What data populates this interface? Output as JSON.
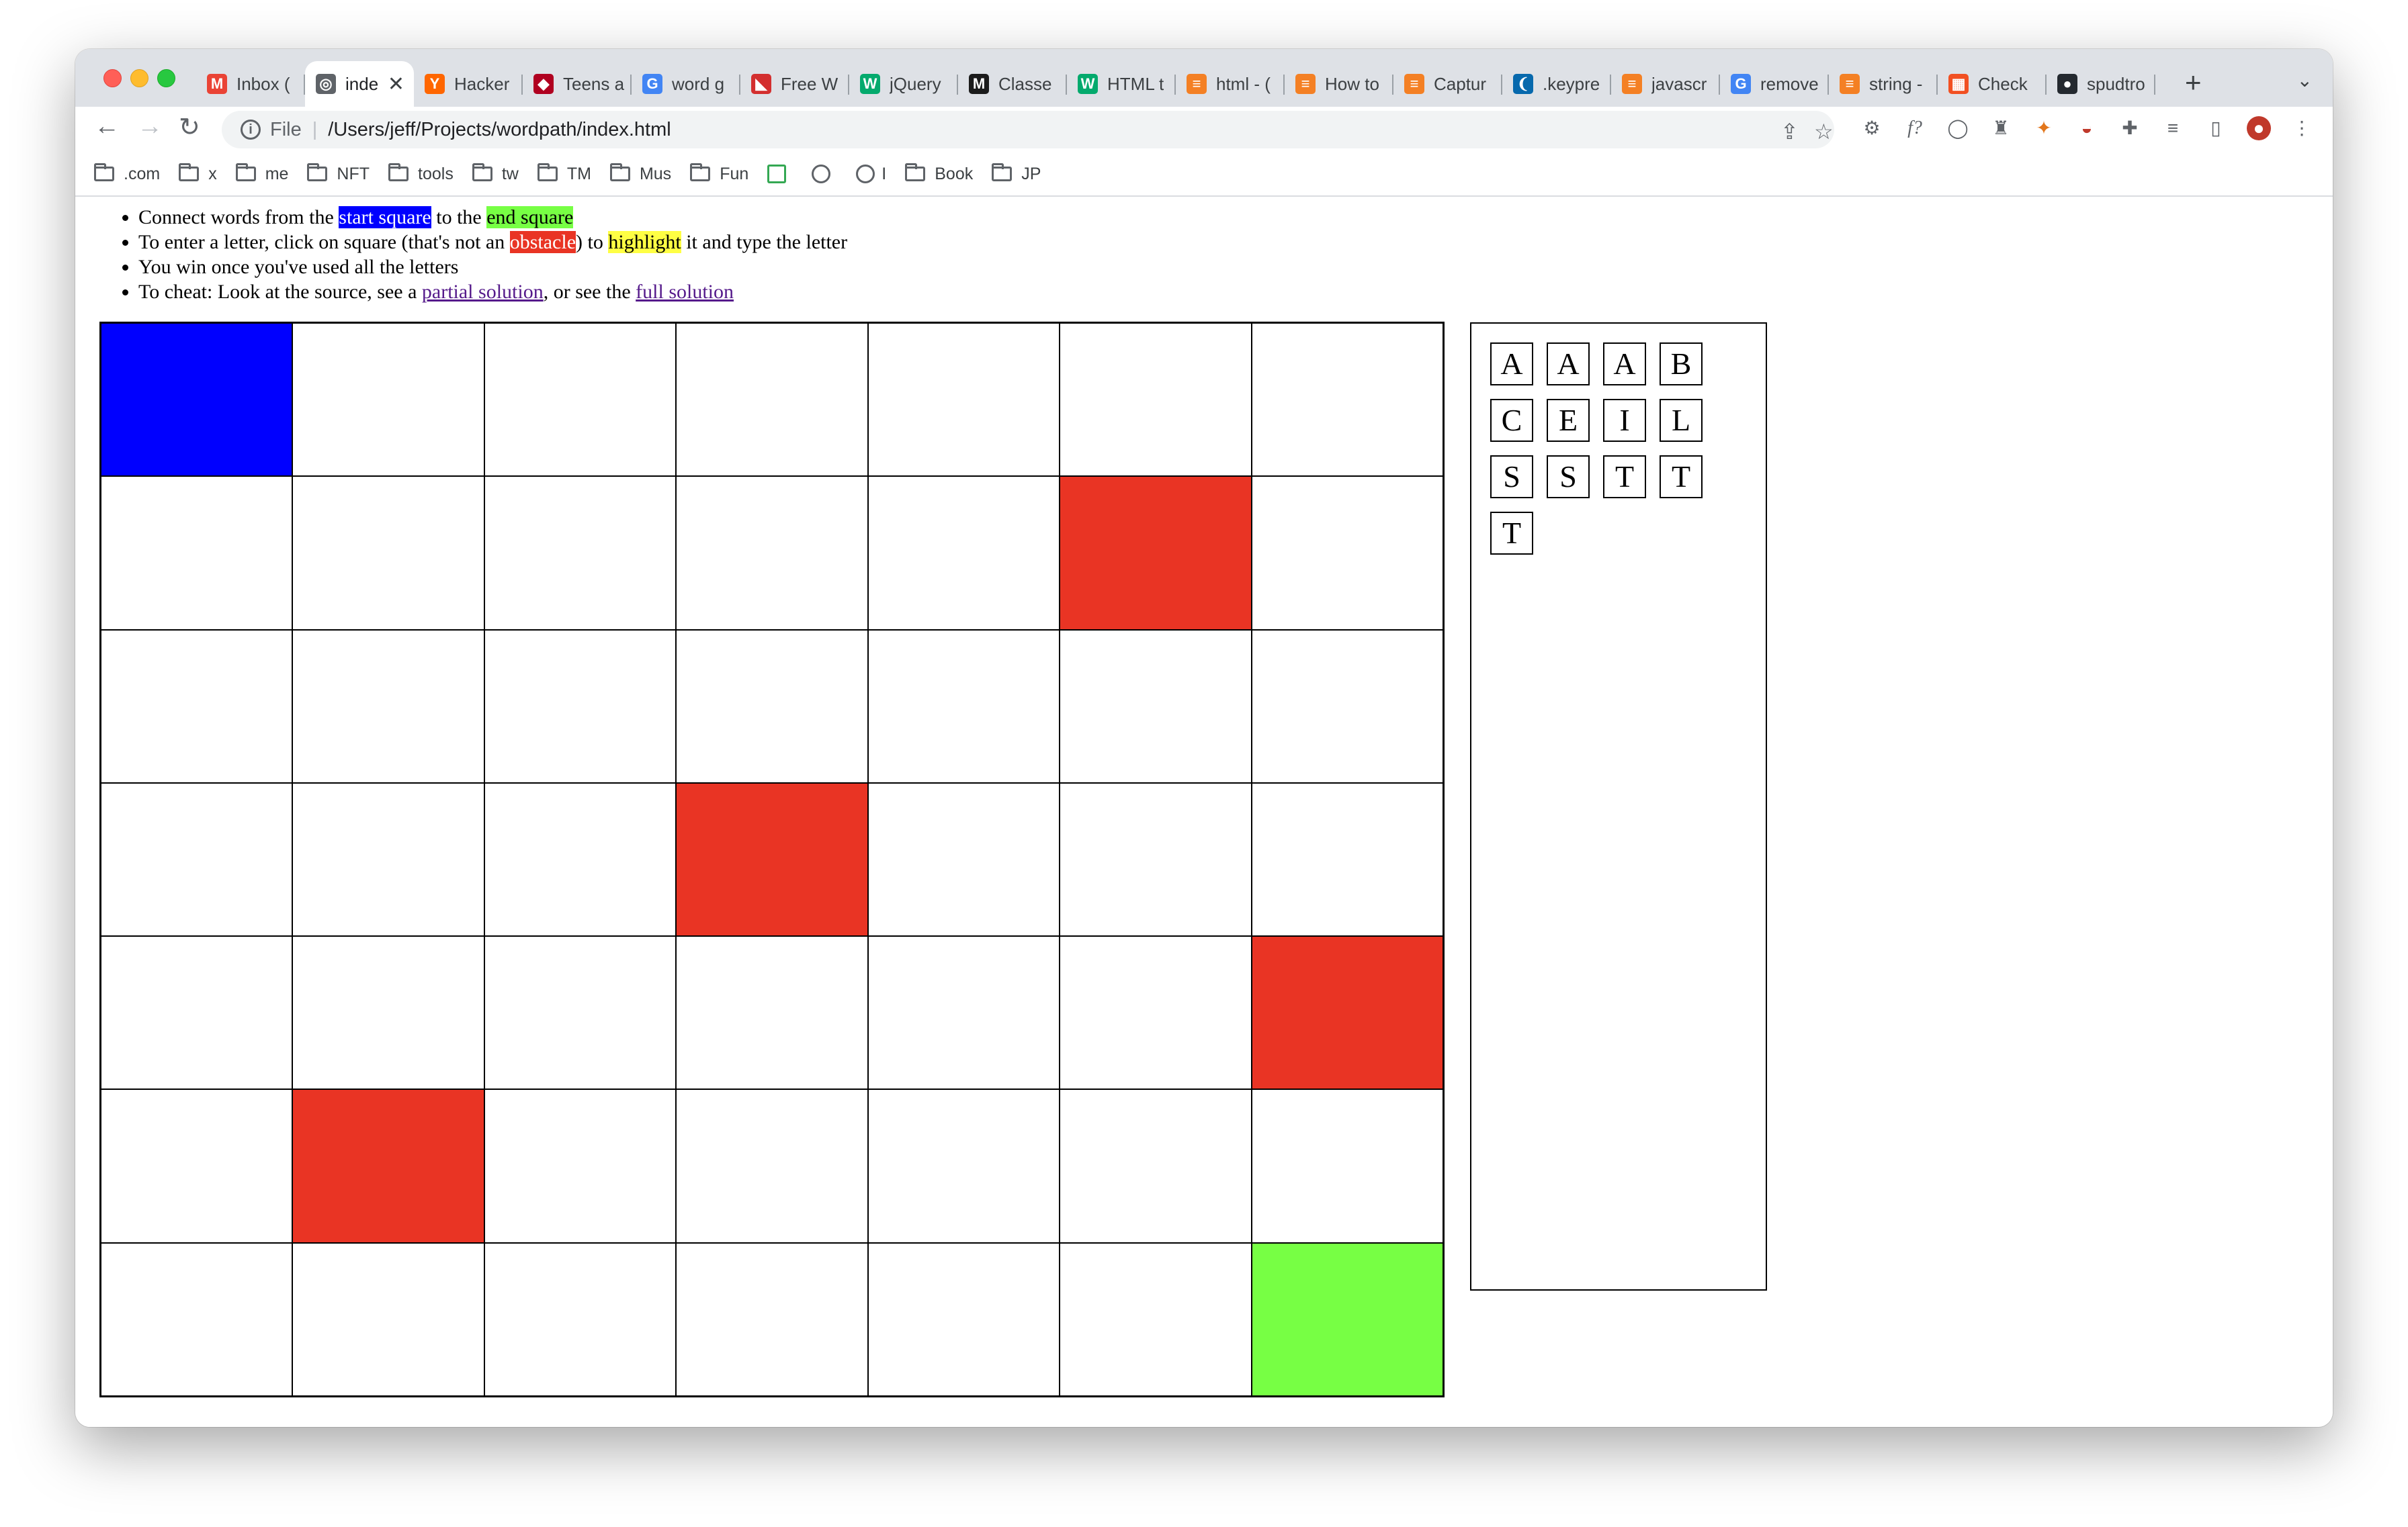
{
  "browser": {
    "tabs": [
      {
        "title": "Inbox (",
        "icon": "gmail-icon",
        "color": "#ea4335",
        "glyph": "M"
      },
      {
        "title": "inde",
        "icon": "globe-icon",
        "color": "#5f6368",
        "glyph": "◎",
        "active": true
      },
      {
        "title": "Hacker",
        "icon": "hacker-news-icon",
        "color": "#ff6600",
        "glyph": "Y"
      },
      {
        "title": "Teens a",
        "icon": "red-diamond-icon",
        "color": "#b00020",
        "glyph": "◆"
      },
      {
        "title": "word g",
        "icon": "google-icon",
        "color": "#4285f4",
        "glyph": "G"
      },
      {
        "title": "Free W",
        "icon": "bookmark-red-icon",
        "color": "#d32f2f",
        "glyph": "◣"
      },
      {
        "title": "jQuery",
        "icon": "w3schools-icon",
        "color": "#04aa6d",
        "glyph": "W"
      },
      {
        "title": "Classe",
        "icon": "mdn-icon",
        "color": "#1b1b1b",
        "glyph": "M"
      },
      {
        "title": "HTML t",
        "icon": "w3schools-icon",
        "color": "#04aa6d",
        "glyph": "W"
      },
      {
        "title": "html - (",
        "icon": "stackoverflow-icon",
        "color": "#f48024",
        "glyph": "≡"
      },
      {
        "title": "How to",
        "icon": "stackoverflow-icon",
        "color": "#f48024",
        "glyph": "≡"
      },
      {
        "title": "Captur",
        "icon": "stackoverflow-icon",
        "color": "#f48024",
        "glyph": "≡"
      },
      {
        "title": ".keypre",
        "icon": "jquery-icon",
        "color": "#0769ad",
        "glyph": "❨"
      },
      {
        "title": "javascr",
        "icon": "stackoverflow-icon",
        "color": "#f48024",
        "glyph": "≡"
      },
      {
        "title": "remove",
        "icon": "google-icon",
        "color": "#4285f4",
        "glyph": "G"
      },
      {
        "title": "string -",
        "icon": "stackoverflow-icon",
        "color": "#f48024",
        "glyph": "≡"
      },
      {
        "title": "Check",
        "icon": "microsoft-icon",
        "color": "#f25022",
        "glyph": "▦"
      },
      {
        "title": "spudtro",
        "icon": "github-icon",
        "color": "#24292f",
        "glyph": "●"
      }
    ],
    "active_tab_close": "✕",
    "new_tab": "+",
    "tab_search": "⌄",
    "scheme": "File",
    "url": "/Users/jeff/Projects/wordpath/index.html",
    "bookmarks": [
      {
        "label": ".com",
        "type": "folder"
      },
      {
        "label": "x",
        "type": "folder"
      },
      {
        "label": "me",
        "type": "folder"
      },
      {
        "label": "NFT",
        "type": "folder"
      },
      {
        "label": "tools",
        "type": "folder"
      },
      {
        "label": "tw",
        "type": "folder"
      },
      {
        "label": "TM",
        "type": "folder"
      },
      {
        "label": "Mus",
        "type": "folder"
      },
      {
        "label": "Fun",
        "type": "folder"
      },
      {
        "label": "",
        "type": "drive"
      },
      {
        "label": "",
        "type": "globe"
      },
      {
        "label": "I",
        "type": "globe"
      },
      {
        "label": "Book",
        "type": "folder"
      },
      {
        "label": "JP",
        "type": "folder"
      }
    ]
  },
  "instructions": {
    "line1": {
      "pre": "Connect words from the ",
      "start": "start square",
      "mid": " to the ",
      "end": "end square"
    },
    "line2": {
      "pre": "To enter a letter, click on square (that's not an ",
      "obstacle": "obstacle",
      "mid": ") to ",
      "highlight": "highlight",
      "post": " it and type the letter"
    },
    "line3": "You win once you've used all the letters",
    "line4": {
      "pre": "To cheat: Look at the source, see a ",
      "partial": "partial solution",
      "mid": ", or see the ",
      "full": "full solution"
    }
  },
  "board": {
    "rows": 7,
    "cols": 7,
    "start": [
      0,
      0
    ],
    "end": [
      6,
      6
    ],
    "obstacles": [
      [
        1,
        5
      ],
      [
        3,
        3
      ],
      [
        4,
        6
      ],
      [
        5,
        1
      ]
    ],
    "colors": {
      "start": "#0000ff",
      "end": "#77ff44",
      "obstacle": "#e93424"
    }
  },
  "letters": [
    "A",
    "A",
    "A",
    "B",
    "C",
    "E",
    "I",
    "L",
    "S",
    "S",
    "T",
    "T",
    "T"
  ]
}
